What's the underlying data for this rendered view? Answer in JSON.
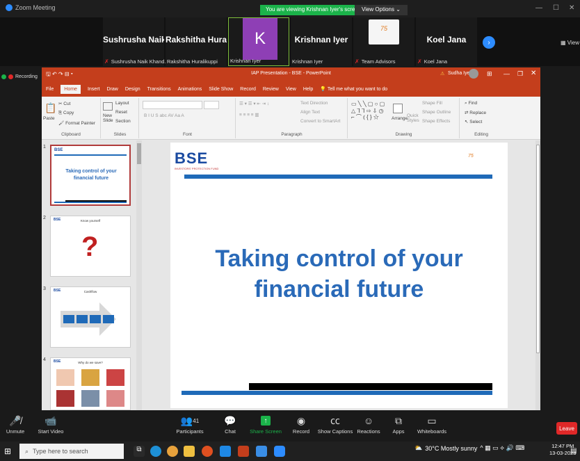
{
  "window": {
    "app_name": "Zoom Meeting",
    "viewing_banner": "You are viewing Krishnan Iyer's screen",
    "view_options": "View Options ⌄",
    "view_label": "View"
  },
  "participants": [
    {
      "name": "Sushrusha Naik...",
      "sub": "Sushrusha Naik Khand..."
    },
    {
      "name": "Rakshitha Hural...",
      "sub": "Rakshitha Huralikuppi"
    },
    {
      "name": "K",
      "sub": "Krishnan Iyer"
    },
    {
      "name": "Krishnan Iyer",
      "sub": "Krishnan Iyer"
    },
    {
      "name": "",
      "sub": "Team Advisors"
    },
    {
      "name": "Koel Jana",
      "sub": "Koel Jana"
    }
  ],
  "recording": "Recording",
  "ppt": {
    "doc_title": "IAP Presentation - BSE - PowerPoint",
    "user": "Sudha Iyer",
    "warning": "⚠",
    "menu": [
      "File",
      "Home",
      "Insert",
      "Draw",
      "Design",
      "Transitions",
      "Animations",
      "Slide Show",
      "Record",
      "Review",
      "View",
      "Help",
      "Tell me what you want to do"
    ],
    "clipboard": {
      "paste": "Paste",
      "cut": "Cut",
      "copy": "Copy",
      "format_painter": "Format Painter",
      "label": "Clipboard"
    },
    "slides": {
      "new_slide": "New Slide",
      "layout": "Layout",
      "reset": "Reset",
      "section": "Section",
      "label": "Slides"
    },
    "font": {
      "label": "Font",
      "bold": "B",
      "italic": "I",
      "underline": "U",
      "strike": "S"
    },
    "paragraph": {
      "label": "Paragraph",
      "text_direction": "Text Direction",
      "align_text": "Align Text",
      "smartart": "Convert to SmartArt"
    },
    "drawing": {
      "label": "Drawing",
      "arrange": "Arrange",
      "quick_styles": "Quick Styles",
      "shape_fill": "Shape Fill",
      "shape_outline": "Shape Outline",
      "shape_effects": "Shape Effects"
    },
    "editing": {
      "label": "Editing",
      "find": "Find",
      "replace": "Replace",
      "select": "Select"
    },
    "thumbs": [
      {
        "num": "1",
        "title": "Taking control of your financial future"
      },
      {
        "num": "2",
        "title": "Know yourself"
      },
      {
        "num": "3",
        "title": "Cashflow"
      },
      {
        "num": "4",
        "title": "Why do we save?"
      }
    ],
    "slide": {
      "logo": "BSE",
      "tagline": "INVESTORS' PROTECTION FUND",
      "title_line1": "Taking control of your",
      "title_line2": "financial future"
    }
  },
  "controls": [
    {
      "label": "Unmute",
      "icon": "mic-off-icon"
    },
    {
      "label": "Start Video",
      "icon": "video-off-icon"
    },
    {
      "label": "Participants",
      "icon": "participants-icon",
      "count": "41"
    },
    {
      "label": "Chat",
      "icon": "chat-icon"
    },
    {
      "label": "Share Screen",
      "icon": "share-icon"
    },
    {
      "label": "Record",
      "icon": "record-icon"
    },
    {
      "label": "Show Captions",
      "icon": "cc-icon"
    },
    {
      "label": "Reactions",
      "icon": "reactions-icon"
    },
    {
      "label": "Apps",
      "icon": "apps-icon"
    },
    {
      "label": "Whiteboards",
      "icon": "whiteboard-icon"
    }
  ],
  "leave": "Leave",
  "taskbar": {
    "search": "Type here to search",
    "weather": "30°C  Mostly sunny",
    "time": "12:47 PM",
    "date": "13-03-2023"
  },
  "colors": {
    "ppt_red": "#c43e1c",
    "zoom_green": "#1bb34a",
    "bse_blue": "#1a4aa0",
    "slide_title": "#2a6ab8"
  }
}
